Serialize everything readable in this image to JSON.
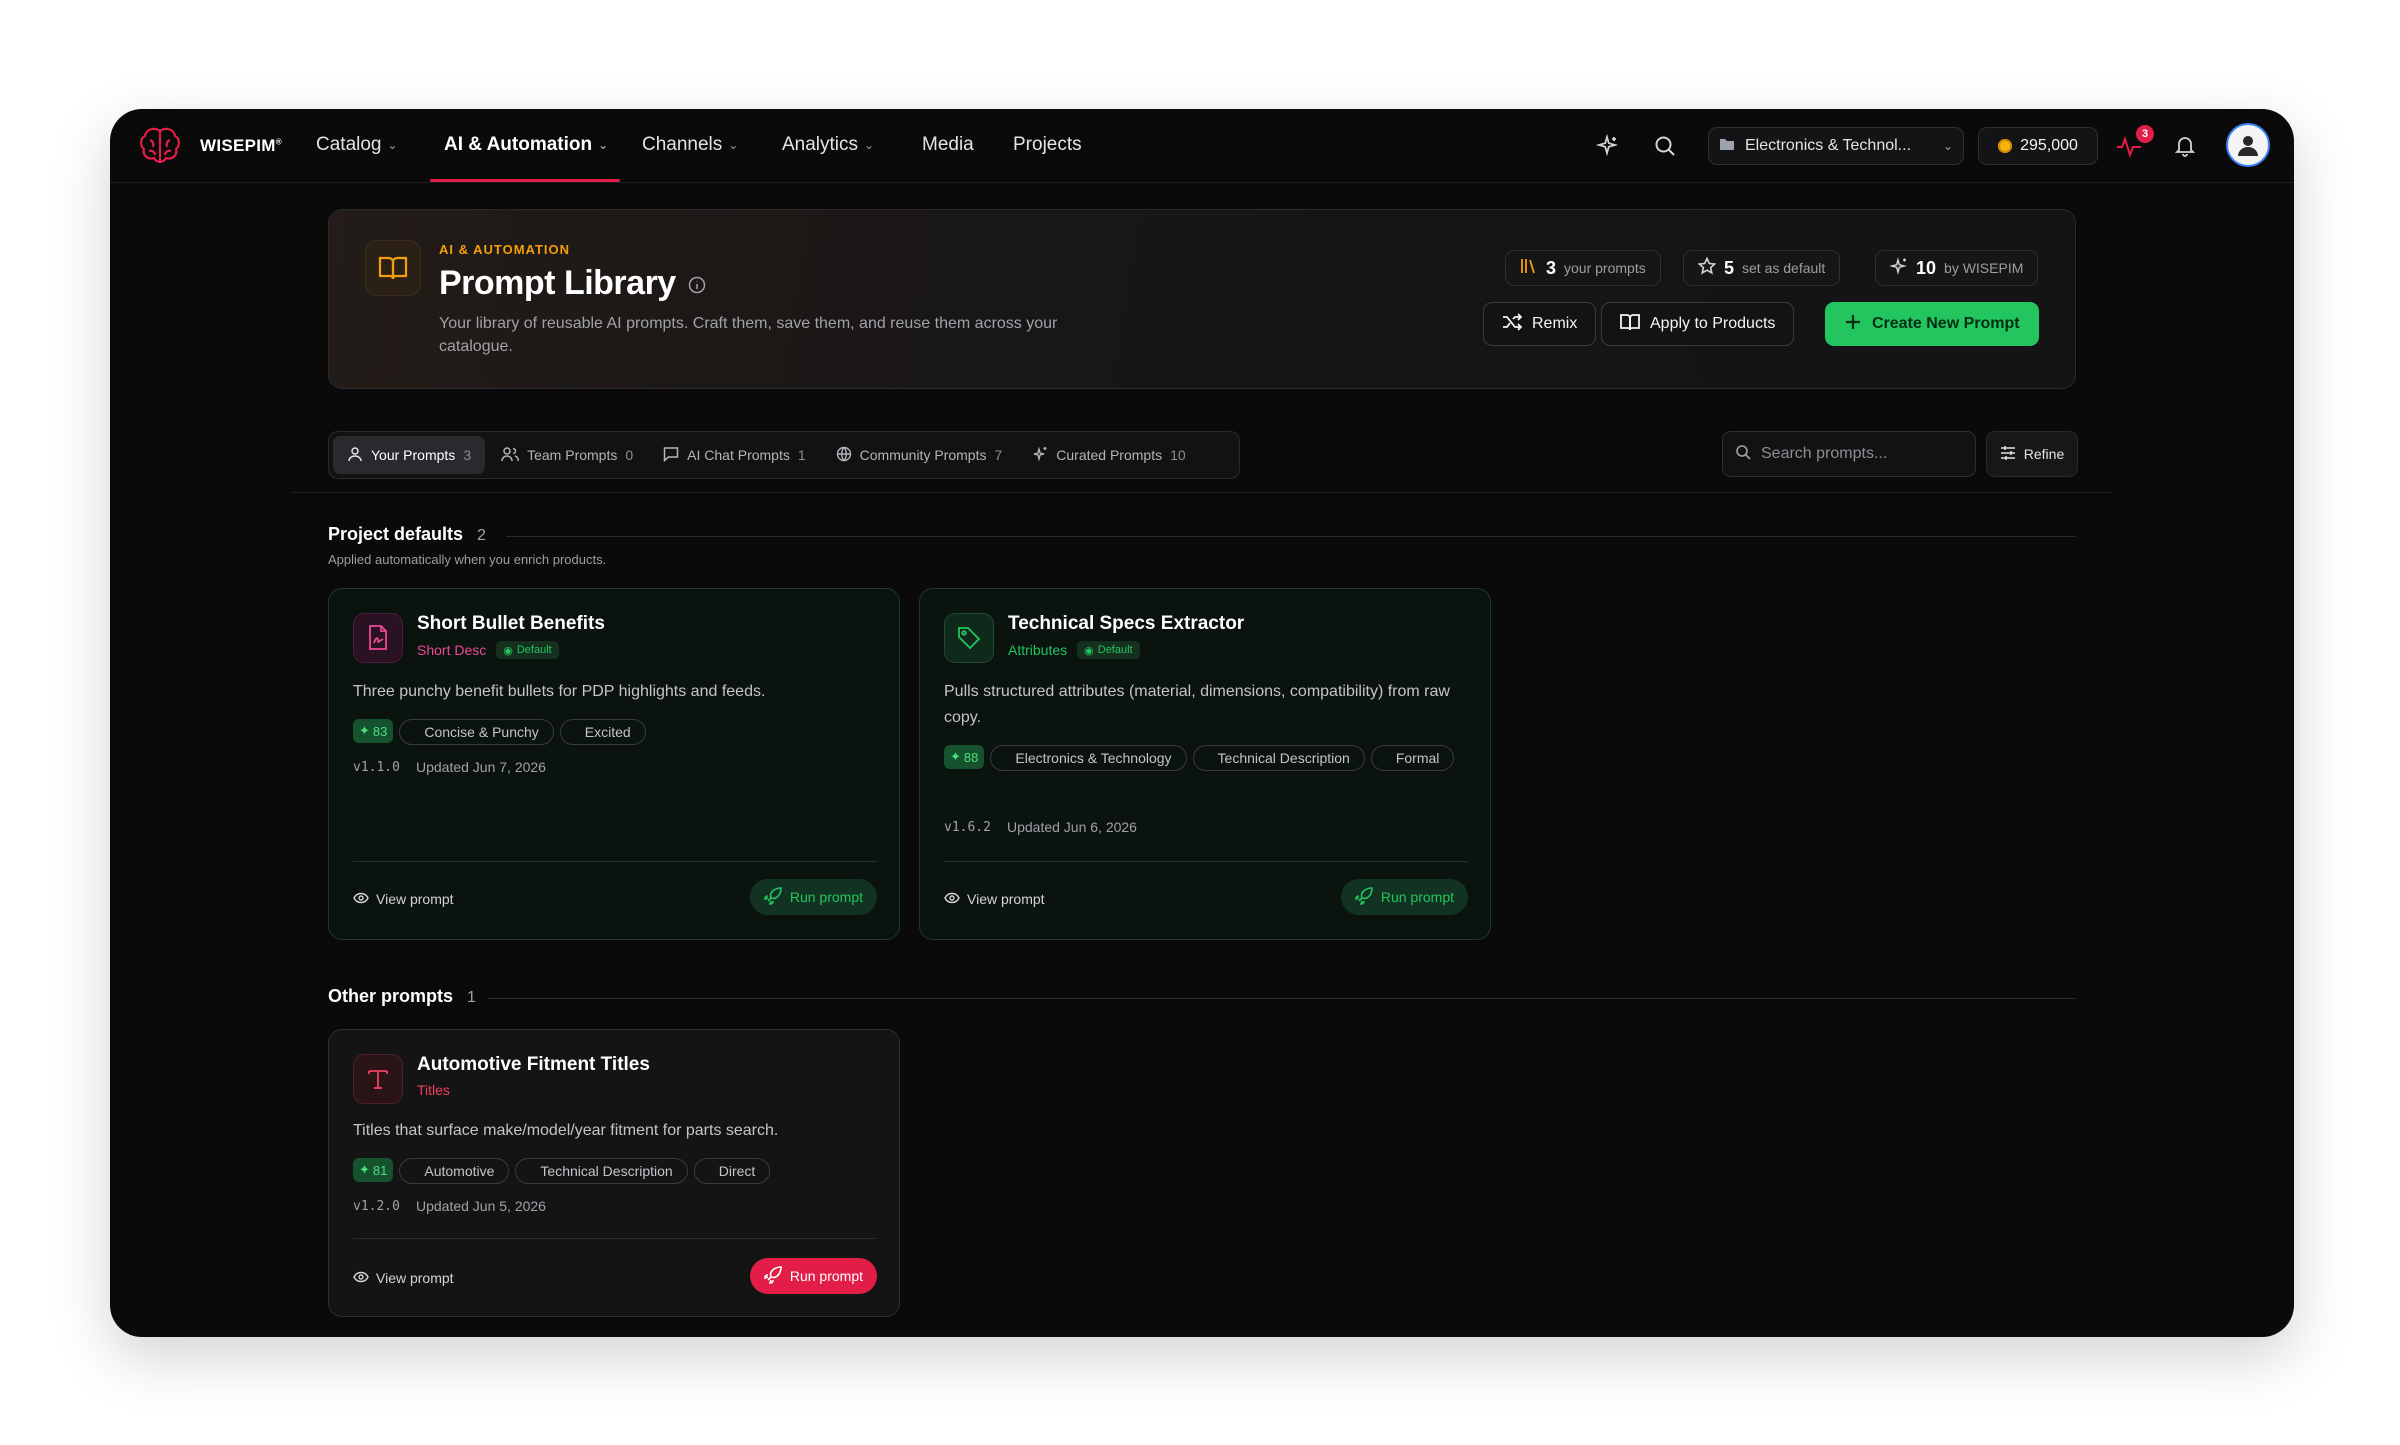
{
  "nav": {
    "brand": "WISEPIM",
    "brand_mark": "®",
    "items": [
      {
        "label": "Catalog",
        "dropdown": true
      },
      {
        "label": "AI & Automation",
        "dropdown": true,
        "active": true
      },
      {
        "label": "Channels",
        "dropdown": true
      },
      {
        "label": "Analytics",
        "dropdown": true
      },
      {
        "label": "Media",
        "dropdown": false
      },
      {
        "label": "Projects",
        "dropdown": false
      }
    ],
    "project_select": "Electronics & Technol...",
    "credits": "295,000",
    "activity_badge": "3",
    "accent": "#e11d48"
  },
  "hero": {
    "eyebrow": "AI & AUTOMATION",
    "title": "Prompt Library",
    "description": "Your library of reusable AI prompts. Craft them, save them, and reuse them across your catalogue.",
    "stats": [
      {
        "value": "3",
        "label": "your prompts",
        "icon": "library-icon"
      },
      {
        "value": "5",
        "label": "set as default",
        "icon": "star-icon"
      },
      {
        "value": "10",
        "label": "by WISEPIM",
        "icon": "sparkles-icon"
      }
    ],
    "buttons": {
      "remix": "Remix",
      "apply": "Apply to Products",
      "create": "Create New Prompt"
    },
    "primary_color": "#22c55e"
  },
  "tabs": [
    {
      "label": "Your Prompts",
      "count": "3",
      "active": true
    },
    {
      "label": "Team Prompts",
      "count": "0"
    },
    {
      "label": "AI Chat Prompts",
      "count": "1"
    },
    {
      "label": "Community Prompts",
      "count": "7"
    },
    {
      "label": "Curated Prompts",
      "count": "10"
    }
  ],
  "search": {
    "placeholder": "Search prompts..."
  },
  "refine_label": "Refine",
  "sections": {
    "defaults": {
      "title": "Project defaults",
      "count": "2",
      "subtitle": "Applied automatically when you enrich products."
    },
    "other": {
      "title": "Other prompts",
      "count": "1"
    }
  },
  "cards": [
    {
      "title": "Short Bullet Benefits",
      "category": "Short Desc",
      "category_color": "#ec4899",
      "default_label": "Default",
      "description": "Three punchy benefit bullets for PDP highlights and feeds.",
      "score": "83",
      "tags": [
        "Concise & Punchy",
        "Excited"
      ],
      "version": "v1.1.0",
      "updated": "Updated Jun 7, 2026",
      "view": "View prompt",
      "run": "Run prompt"
    },
    {
      "title": "Technical Specs Extractor",
      "category": "Attributes",
      "category_color": "#22c55e",
      "default_label": "Default",
      "description": "Pulls structured attributes (material, dimensions, compatibility) from raw copy.",
      "score": "88",
      "tags": [
        "Electronics & Technology",
        "Technical Description",
        "Formal"
      ],
      "version": "v1.6.2",
      "updated": "Updated Jun 6, 2026",
      "view": "View prompt",
      "run": "Run prompt"
    },
    {
      "title": "Automotive Fitment Titles",
      "category": "Titles",
      "category_color": "#f43f5e",
      "description": "Titles that surface make/model/year fitment for parts search.",
      "score": "81",
      "tags": [
        "Automotive",
        "Technical Description",
        "Direct"
      ],
      "version": "v1.2.0",
      "updated": "Updated Jun 5, 2026",
      "view": "View prompt",
      "run": "Run prompt"
    }
  ]
}
